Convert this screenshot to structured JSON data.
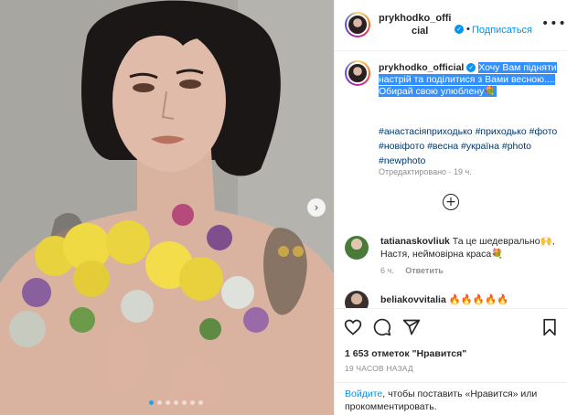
{
  "header": {
    "username_line1": "prykhodko_offi",
    "username_line2": "cial",
    "dot": "•",
    "follow_label": "Подписаться",
    "more_label": "•••"
  },
  "caption": {
    "username": "prykhodko_official",
    "text": "Хочу Вам підняти настрій та поділитися з Вами весною.... Обирай свою улюблену💐",
    "hashtags": "#анастасіяприходько #приходько #фото #новіфото #весна #україна #photo #newphoto",
    "edited": "Отредактировано · 19 ч."
  },
  "comments": [
    {
      "username": "tatianaskovliuk",
      "text": "Та це шедеврально🙌, Настя, неймовірна краса💐",
      "time": "6 ч.",
      "reply_label": "Ответить"
    },
    {
      "username": "beliakovvitalia",
      "text": "🔥🔥🔥🔥🔥"
    }
  ],
  "likes": "1 653 отметок \"Нравится\"",
  "post_time": "19 ЧАСОВ НАЗАД",
  "login_prompt": {
    "link": "Войдите",
    "text": ", чтобы поставить «Нравится» или прокомментировать."
  },
  "icons": {
    "verified": "verified-check-icon",
    "heart": "heart-icon",
    "comment": "comment-icon",
    "share": "share-icon",
    "save": "bookmark-icon",
    "add": "plus-circle-icon",
    "next": "chevron-right-icon"
  },
  "colors": {
    "accent": "#0095f6",
    "selection": "#3390ff",
    "hashtag": "#00376b",
    "muted": "#8e8e8e"
  },
  "carousel": {
    "total": 7,
    "active": 0
  }
}
